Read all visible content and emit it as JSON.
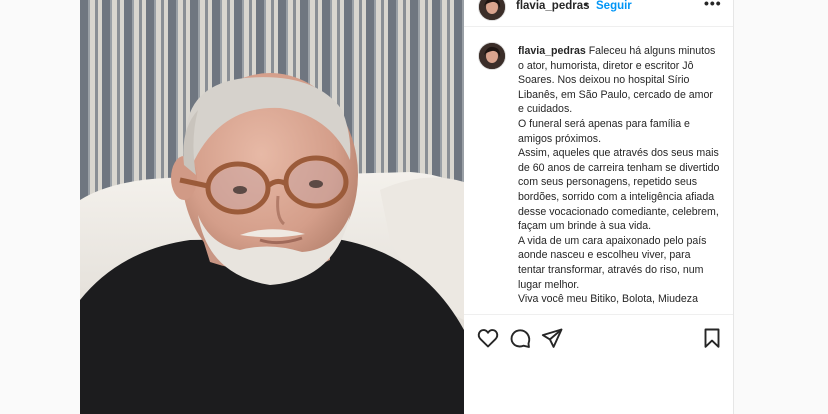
{
  "post": {
    "username": "flavia_pedras",
    "dot": "•",
    "follow_label": "Seguir",
    "more_label": "•••"
  },
  "caption": {
    "username": "flavia_pedras",
    "paragraphs": [
      "Faleceu há alguns minutos o ator, humorista, diretor e escritor Jô Soares. Nos deixou no hospital Sírio Libanês, em São Paulo, cercado de amor e cuidados.",
      "O funeral será apenas para família e amigos próximos.",
      "Assim, aqueles que através dos seus mais de 60 anos de carreira tenham se divertido com seus personagens, repetido seus bordões, sorrido com a inteligência afiada desse vocacionado comediante, celebrem, façam um brinde à sua vida.",
      "A vida de um cara apaixonado pelo país aonde nasceu e escolheu viver, para tentar transformar, através do riso, num lugar melhor.",
      "Viva você meu Bitiko, Bolota, Miudeza"
    ]
  },
  "actions": [
    {
      "icon": "heart-icon"
    },
    {
      "icon": "comment-icon"
    },
    {
      "icon": "share-icon"
    },
    {
      "icon": "bookmark-icon"
    }
  ],
  "colors": {
    "follow": "#0095f6",
    "text": "#262626",
    "border": "#efefef"
  }
}
